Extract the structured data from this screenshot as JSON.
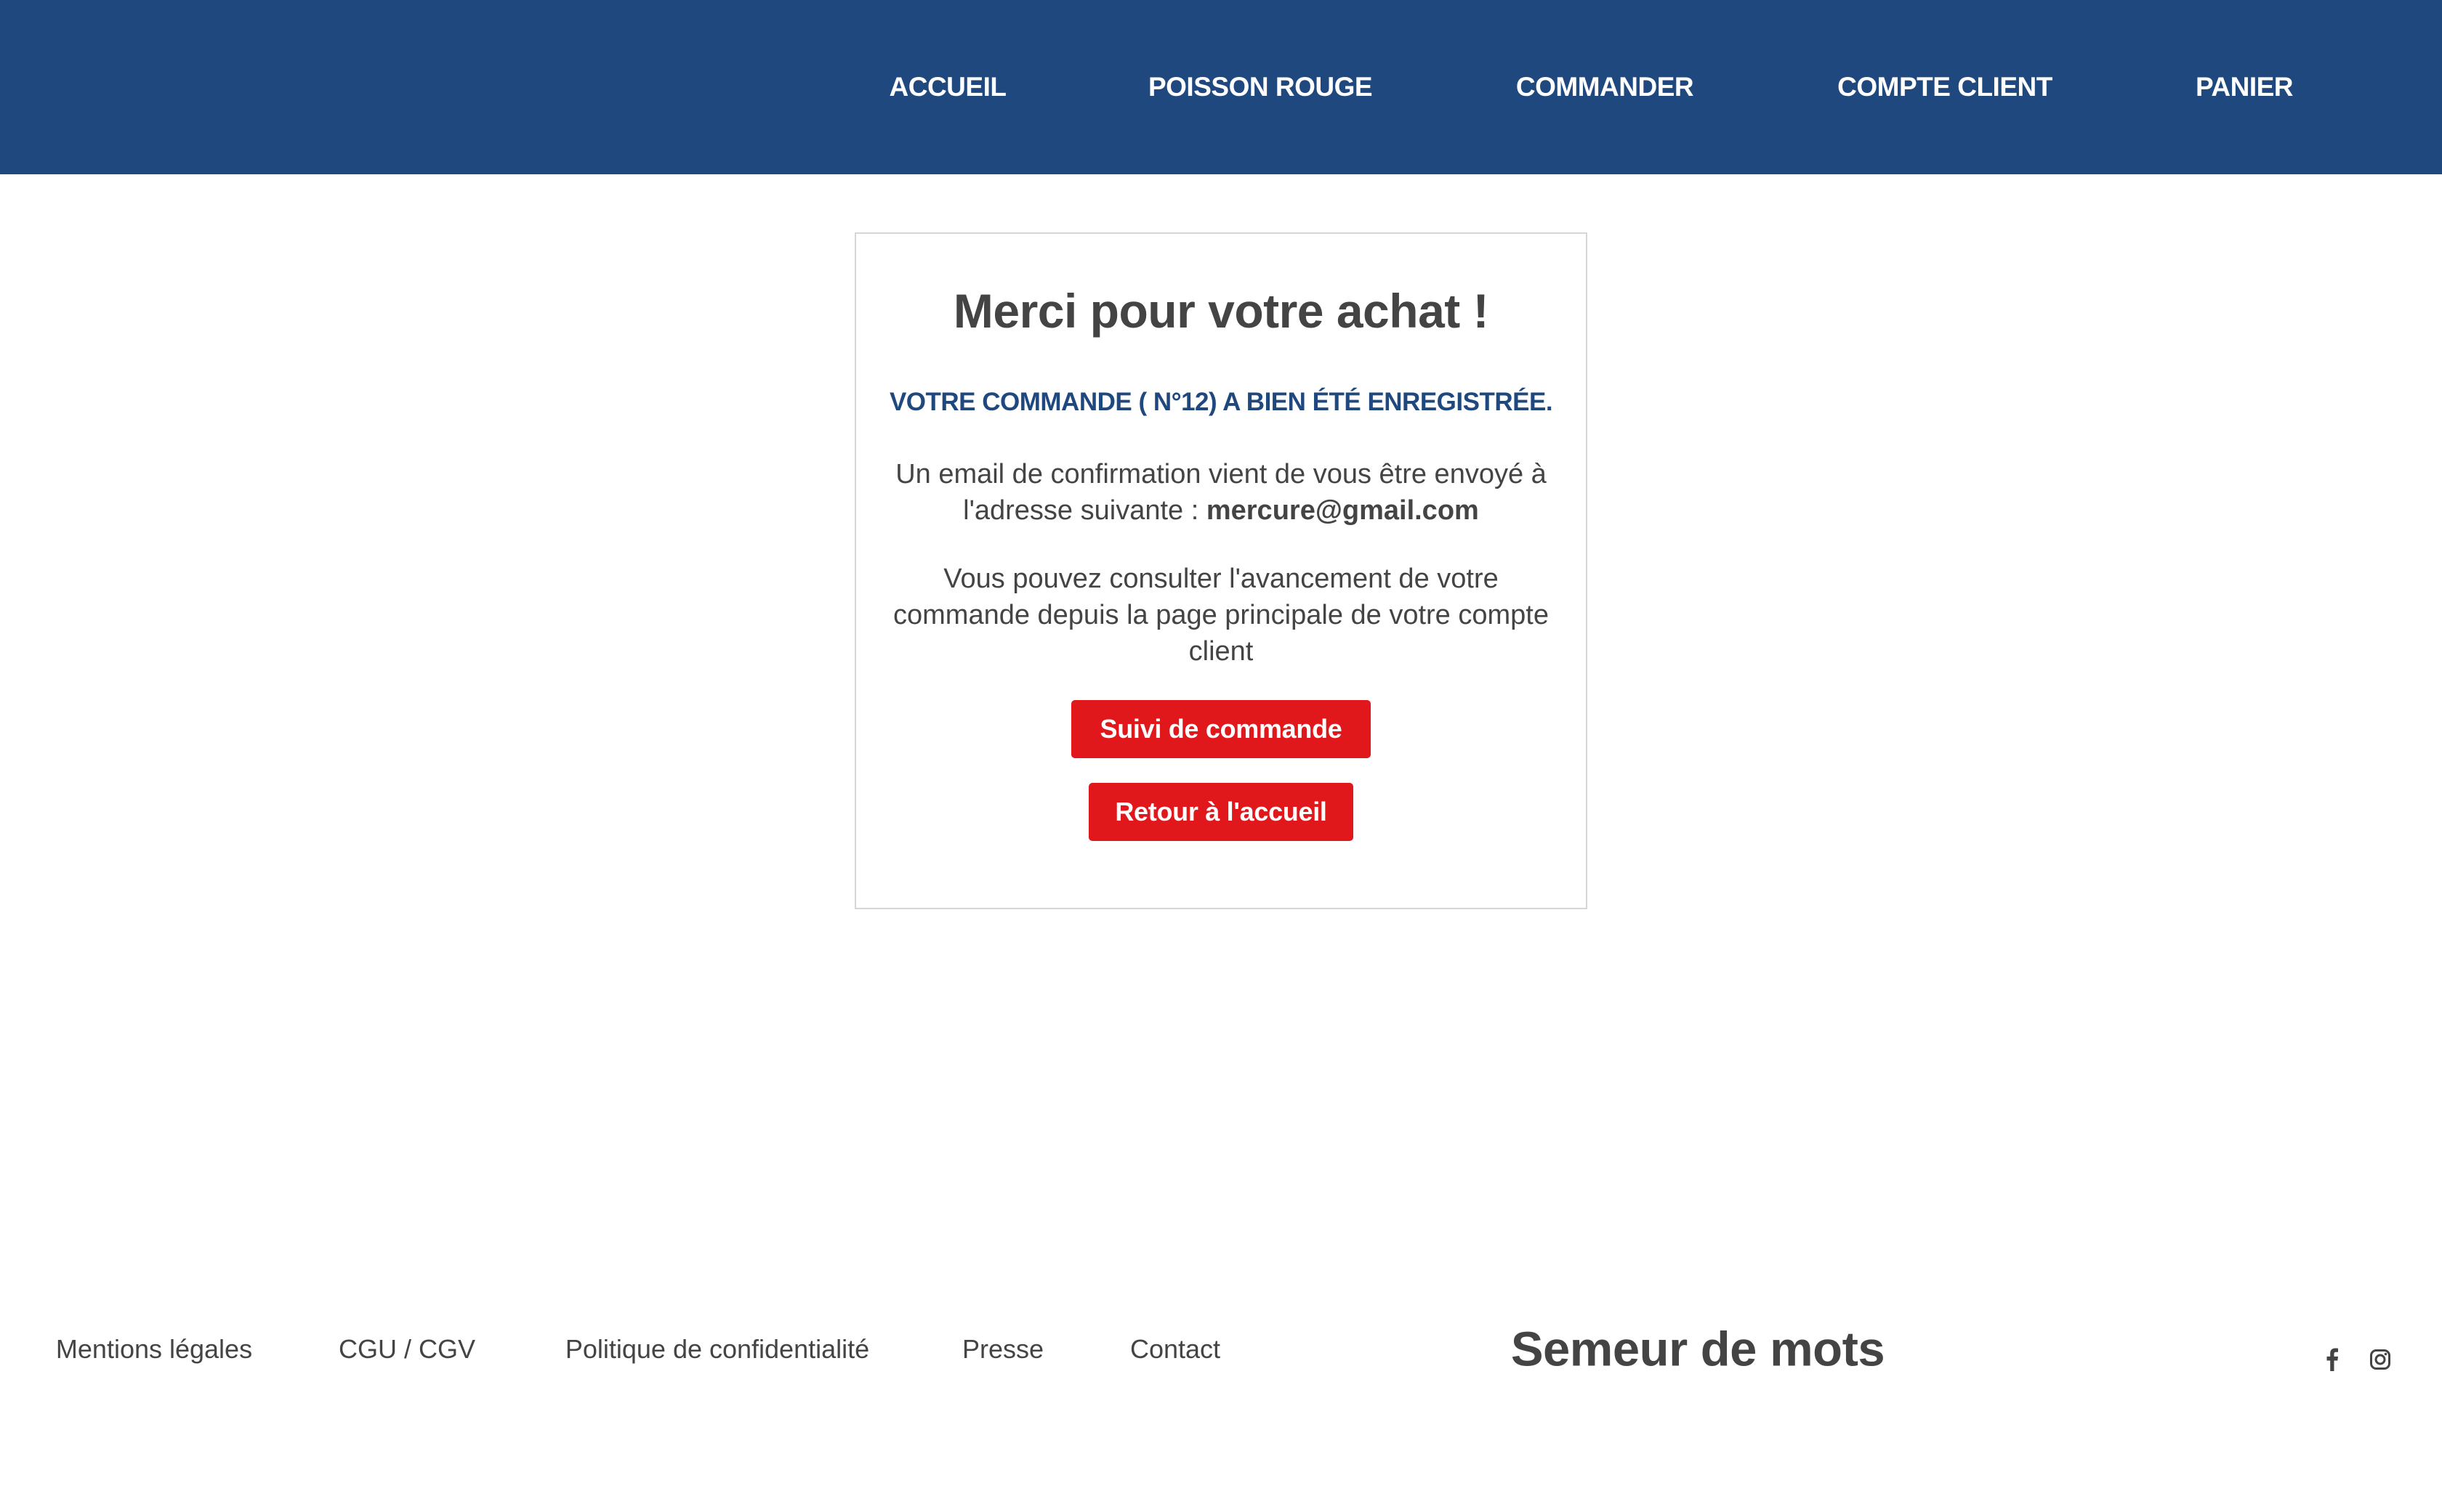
{
  "nav": {
    "items": [
      {
        "label": "ACCUEIL"
      },
      {
        "label": "POISSON ROUGE"
      },
      {
        "label": "COMMANDER"
      },
      {
        "label": "COMPTE CLIENT"
      },
      {
        "label": "PANIER"
      }
    ]
  },
  "confirmation": {
    "title": "Merci pour votre achat !",
    "order_line": "VOTRE COMMANDE ( N°12) A BIEN ÉTÉ ENREGISTRÉE.",
    "email_text": "Un email de confirmation vient de vous être envoyé à l'adresse suivante :",
    "email": "mercure@gmail.com",
    "tracking_text": "Vous pouvez consulter l'avancement de votre commande depuis la page principale de votre compte client",
    "track_button": "Suivi de commande",
    "home_button": "Retour à l'accueil"
  },
  "footer": {
    "links": [
      {
        "label": "Mentions légales"
      },
      {
        "label": "CGU / CGV"
      },
      {
        "label": "Politique de confidentialité"
      },
      {
        "label": "Presse"
      },
      {
        "label": "Contact"
      }
    ],
    "brand": "Semeur de mots",
    "social": [
      {
        "icon": "facebook-icon"
      },
      {
        "icon": "instagram-icon"
      }
    ]
  },
  "colors": {
    "header_bg": "#1f487e",
    "accent_red": "#e0171b",
    "text": "#444444",
    "order_blue": "#1f487e"
  }
}
